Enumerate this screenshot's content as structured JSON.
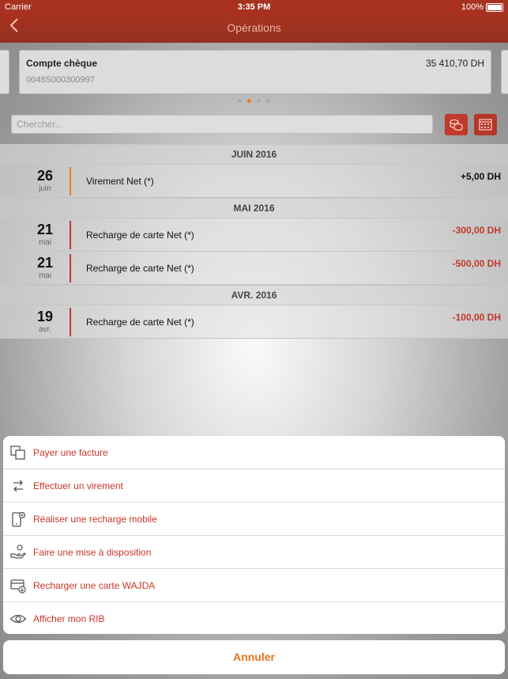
{
  "status": {
    "carrier": "Carrier",
    "time": "3:35 PM",
    "battery": "100%"
  },
  "nav": {
    "title": "Opérations"
  },
  "account": {
    "name": "Compte chèque",
    "balance": "35 410,70 DH",
    "number": "0048S000300997"
  },
  "search": {
    "placeholder": "Chercher..."
  },
  "colors": {
    "brand": "#a8321f",
    "debit": "#c0392b",
    "credit": "#111111",
    "accent": "#e4731c"
  },
  "months": [
    {
      "label": "JUIN 2016",
      "rows": [
        {
          "day": "26",
          "month": "juin",
          "label": "Virement Net (*)",
          "amount": "+5,00 DH",
          "kind": "credit"
        }
      ]
    },
    {
      "label": "MAI 2016",
      "rows": [
        {
          "day": "21",
          "month": "mai",
          "label": "Recharge de carte Net (*)",
          "amount": "-300,00 DH",
          "kind": "debit"
        },
        {
          "day": "21",
          "month": "mai",
          "label": "Recharge de carte Net (*)",
          "amount": "-500,00 DH",
          "kind": "debit"
        }
      ]
    },
    {
      "label": "AVR. 2016",
      "rows": [
        {
          "day": "19",
          "month": "avr.",
          "label": "Recharge de carte Net (*)",
          "amount": "-100,00 DH",
          "kind": "debit"
        }
      ]
    }
  ],
  "actions": [
    {
      "label": "Payer une facture",
      "icon": "copy-icon"
    },
    {
      "label": "Effectuer un virement",
      "icon": "transfer-icon"
    },
    {
      "label": "Réaliser une recharge mobile",
      "icon": "mobile-recharge-icon"
    },
    {
      "label": "Faire une mise à disposition",
      "icon": "hand-coin-icon"
    },
    {
      "label": "Recharger une carte WAJDA",
      "icon": "card-recharge-icon"
    },
    {
      "label": "Afficher mon RIB",
      "icon": "eye-icon"
    }
  ],
  "cancel_label": "Annuler"
}
